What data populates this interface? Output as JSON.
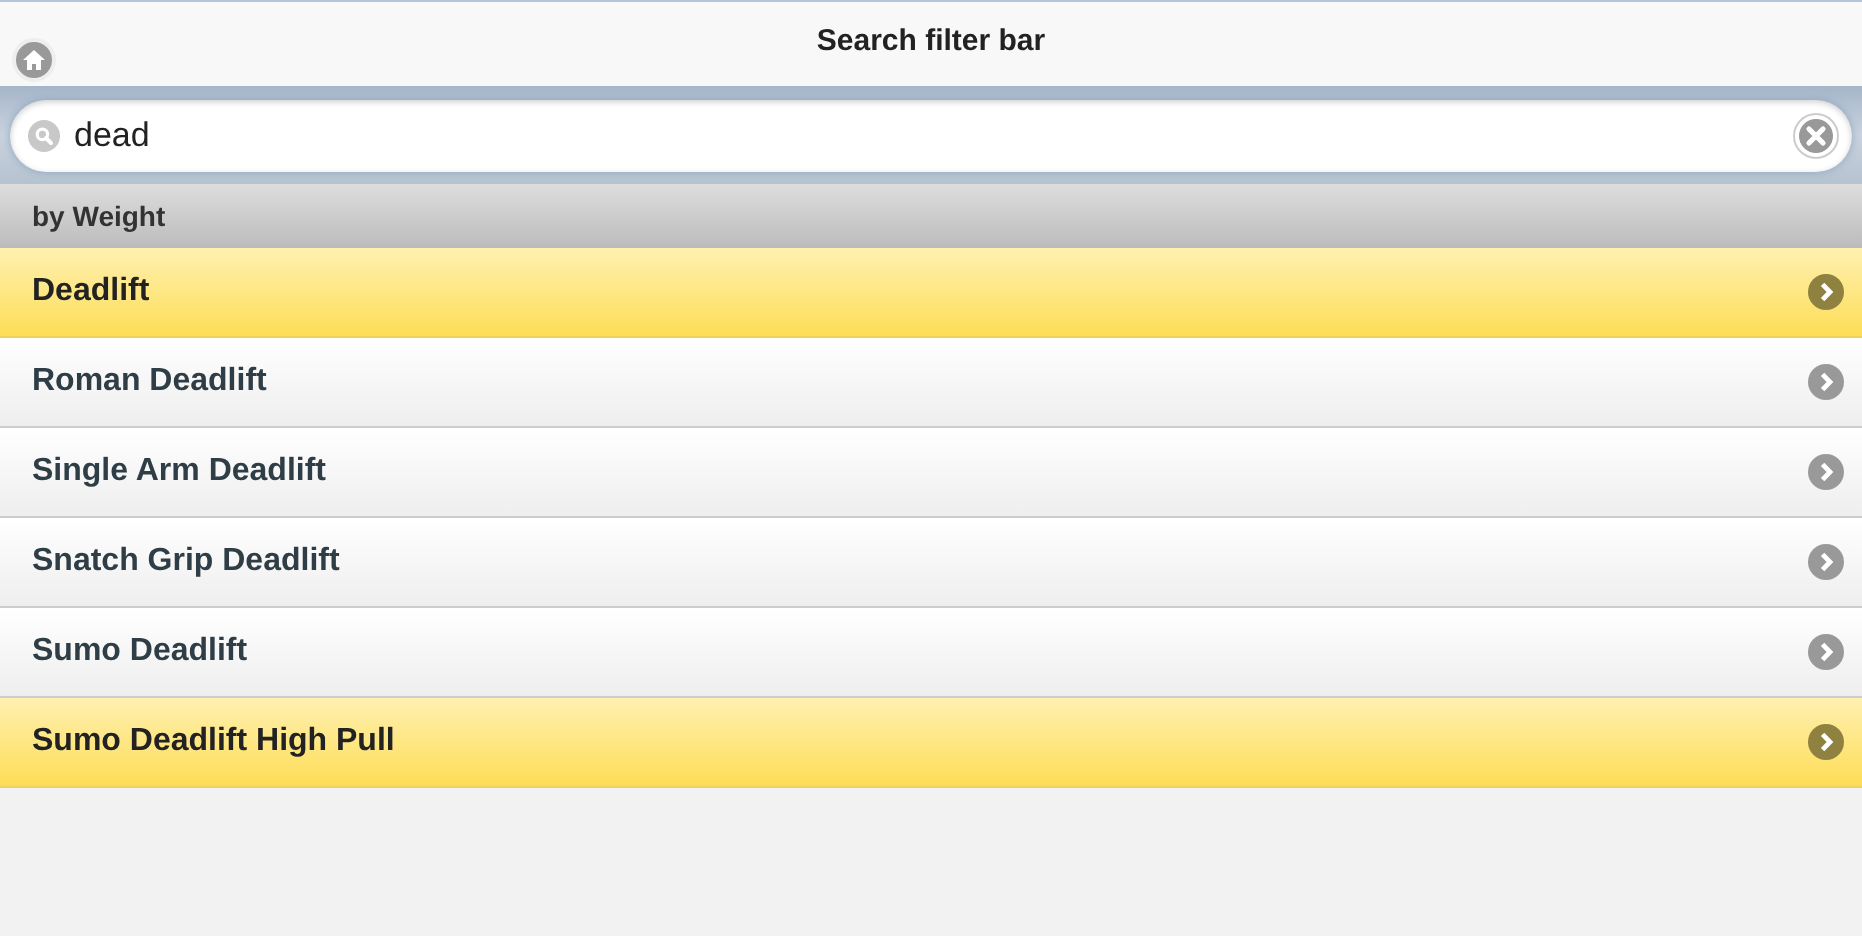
{
  "header": {
    "title": "Search filter bar"
  },
  "search": {
    "value": "dead"
  },
  "list": {
    "divider": "by Weight",
    "items": [
      {
        "label": "Deadlift",
        "selected": true
      },
      {
        "label": "Roman Deadlift",
        "selected": false
      },
      {
        "label": "Single Arm Deadlift",
        "selected": false
      },
      {
        "label": "Snatch Grip Deadlift",
        "selected": false
      },
      {
        "label": "Sumo Deadlift",
        "selected": false
      },
      {
        "label": "Sumo Deadlift High Pull",
        "selected": true
      }
    ]
  }
}
